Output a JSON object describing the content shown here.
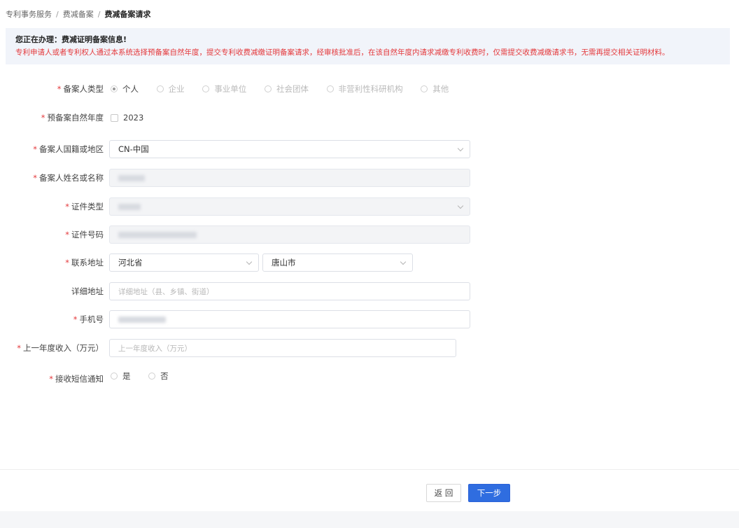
{
  "breadcrumb": {
    "items": [
      "专利事务服务",
      "费减备案"
    ],
    "separator": "/",
    "current": "费减备案请求"
  },
  "notice": {
    "title": "您正在办理：费减证明备案信息!",
    "text": "专利申请人或者专利权人通过本系统选择预备案自然年度，提交专利收费减缴证明备案请求，经审核批准后，在该自然年度内请求减缴专利收费时，仅需提交收费减缴请求书，无需再提交相关证明材料。"
  },
  "form": {
    "applicant_type": {
      "label": "备案人类型",
      "options": [
        "个人",
        "企业",
        "事业单位",
        "社会团体",
        "非营利性科研机构",
        "其他"
      ],
      "selected": "个人"
    },
    "year": {
      "label": "预备案自然年度",
      "value": "2023"
    },
    "nationality": {
      "label": "备案人国籍或地区",
      "value": "CN-中国"
    },
    "name": {
      "label": "备案人姓名或名称"
    },
    "id_type": {
      "label": "证件类型"
    },
    "id_number": {
      "label": "证件号码"
    },
    "address": {
      "label": "联系地址",
      "province": "河北省",
      "city": "唐山市"
    },
    "detail_address": {
      "label": "详细地址",
      "placeholder": "详细地址（县、乡镇、街道）"
    },
    "phone": {
      "label": "手机号"
    },
    "income": {
      "label": "上一年度收入（万元）",
      "placeholder": "上一年度收入（万元）"
    },
    "sms": {
      "label": "接收短信通知",
      "options": [
        "是",
        "否"
      ]
    },
    "required_mark": "*"
  },
  "footer": {
    "back_label": "返 回",
    "next_label": "下一步"
  },
  "colors": {
    "primary": "#2f6de0",
    "required": "#e4393c",
    "notice_bg": "#f1f4fa"
  }
}
